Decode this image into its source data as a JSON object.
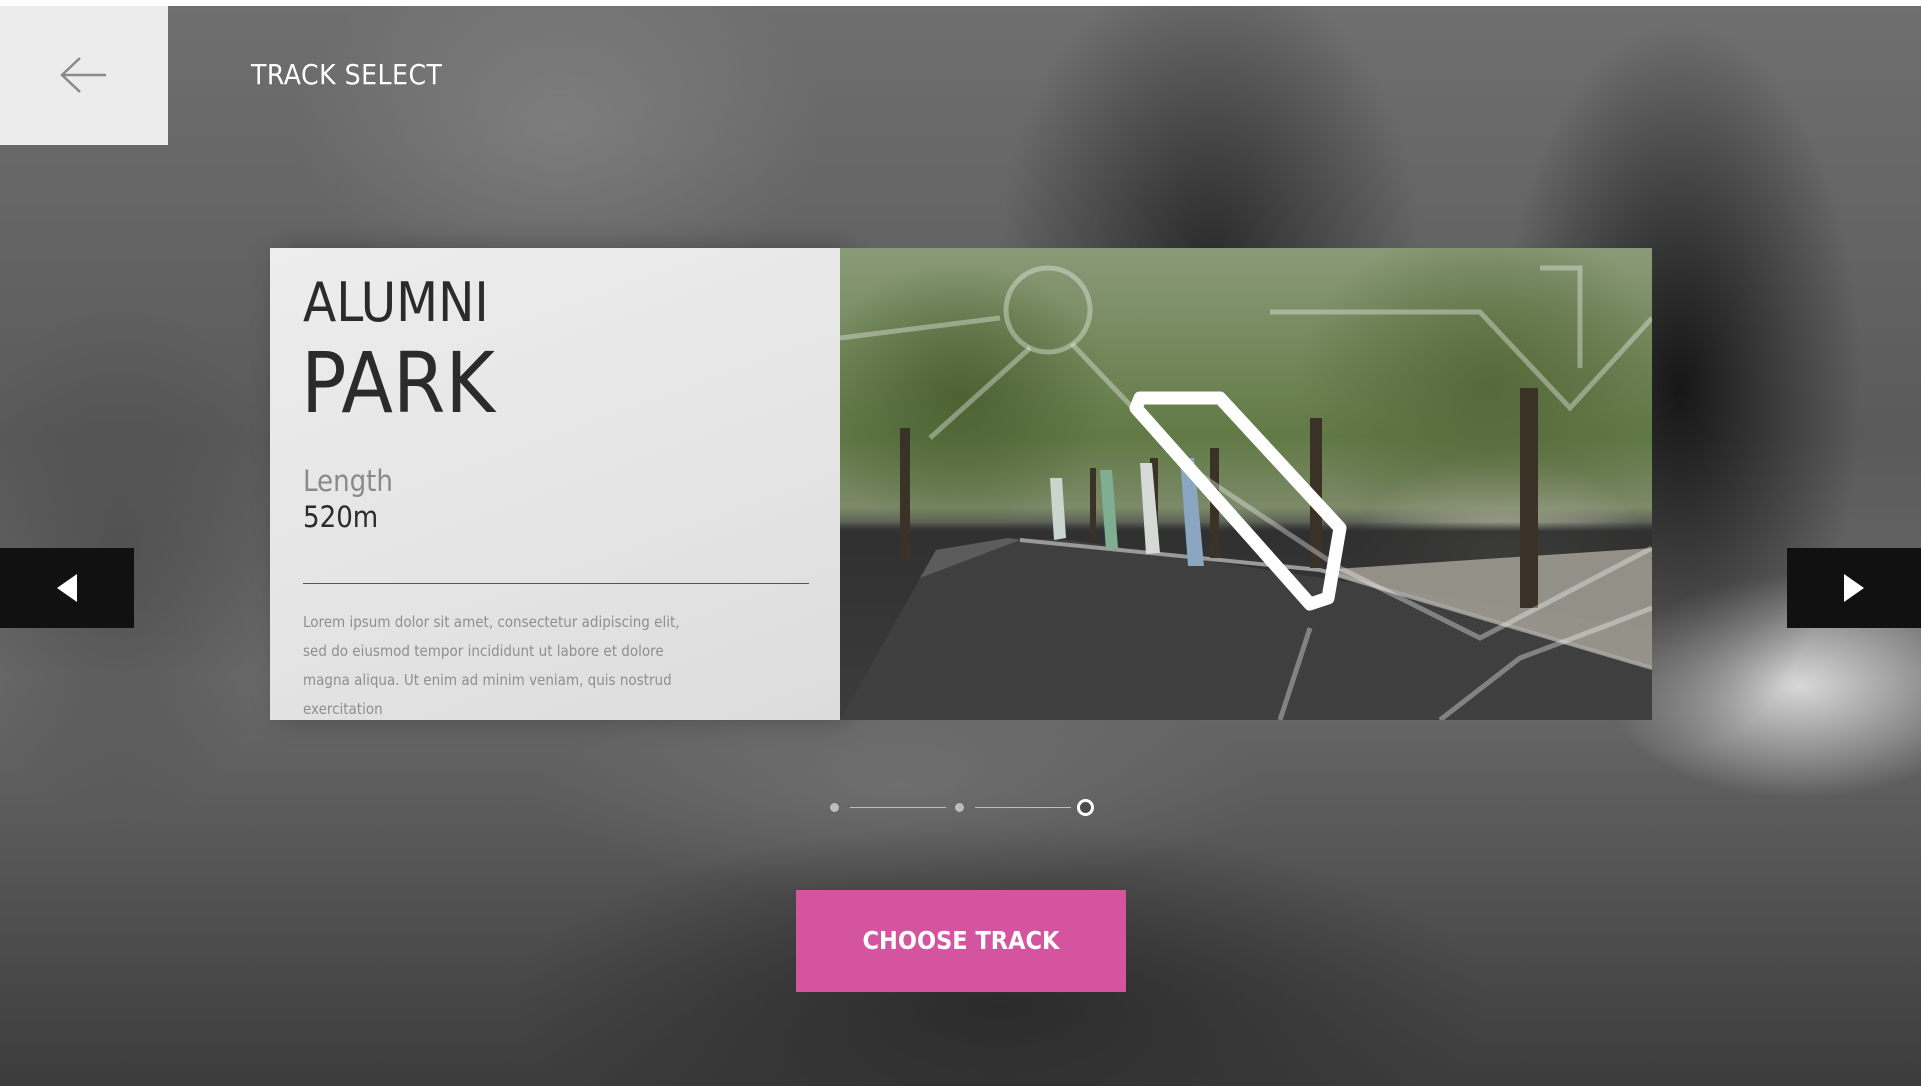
{
  "header": {
    "back_icon": "arrow-left-icon",
    "title": "TRACK SELECT"
  },
  "track": {
    "name_line1": "ALUMNI",
    "name_line2": "PARK",
    "length_label": "Length",
    "length_value": "520m",
    "description": "Lorem ipsum dolor sit amet, consectetur adipiscing elit, sed do eiusmod tempor incididunt ut labore et dolore magna aliqua. Ut enim ad minim veniam, quis nostrud exercitation"
  },
  "navigation": {
    "prev_icon": "triangle-left-icon",
    "next_icon": "triangle-right-icon"
  },
  "pager": {
    "total": 3,
    "active_index": 2
  },
  "action": {
    "choose_label": "CHOOSE TRACK"
  },
  "colors": {
    "accent": "#d4549f",
    "panel": "#e6e6e6",
    "arrow_bg": "#111111"
  }
}
